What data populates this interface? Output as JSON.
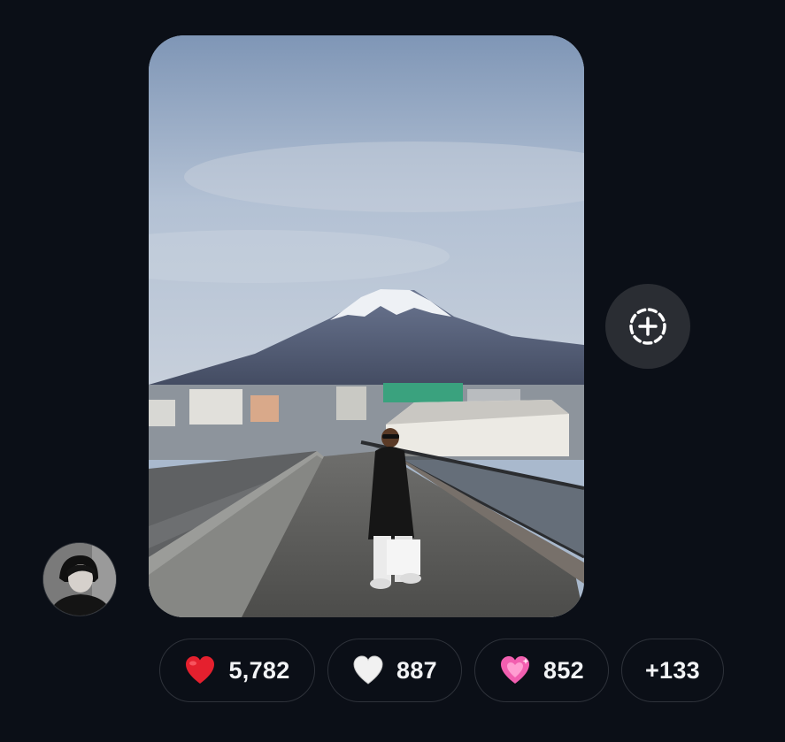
{
  "message": {
    "image_alt": "Woman on an overpass walkway with snow-capped Mount Fuji behind a city",
    "add_reaction_icon": "add-reaction-icon"
  },
  "sender": {
    "avatar": "avatar"
  },
  "reactions": [
    {
      "emoji": "red-heart",
      "count": "5,782"
    },
    {
      "emoji": "white-heart",
      "count": "887"
    },
    {
      "emoji": "pink-sparkling-heart",
      "count": "852"
    }
  ],
  "more_reactions": "+133",
  "colors": {
    "background": "#0b0f17",
    "pill_border": "#2e323a",
    "add_button_bg": "#2a2d33",
    "text": "#f2f3f5"
  }
}
